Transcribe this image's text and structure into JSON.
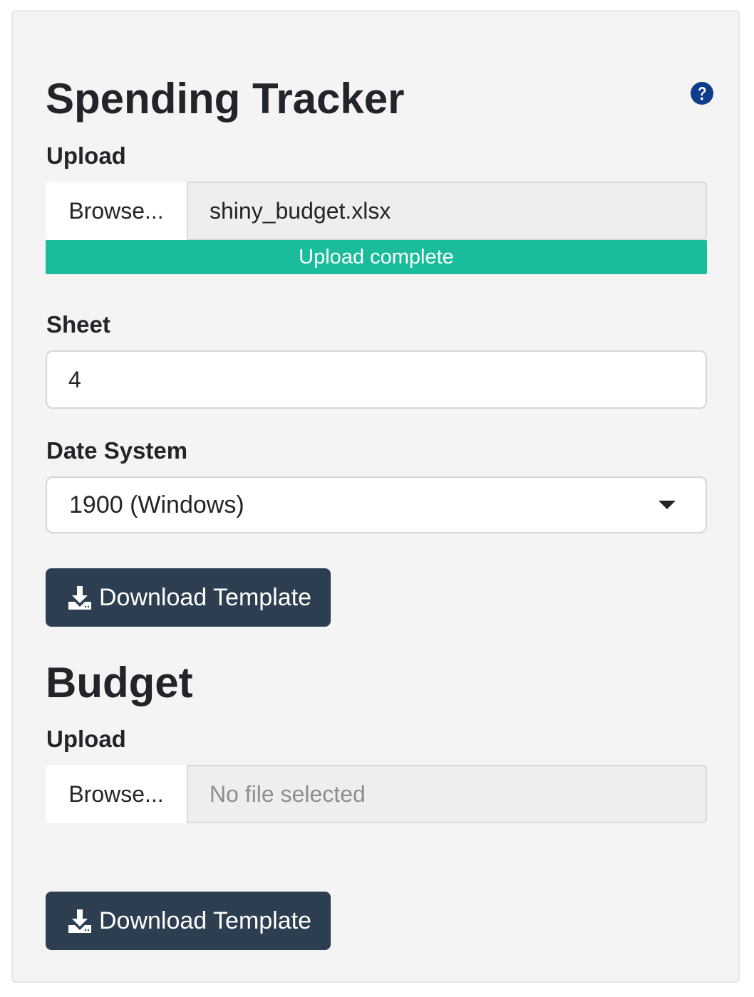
{
  "spending_tracker": {
    "title": "Spending Tracker",
    "upload_label": "Upload",
    "browse_label": "Browse...",
    "file_name": "shiny_budget.xlsx",
    "progress_text": "Upload complete",
    "progress_value": 1.0,
    "sheet_label": "Sheet",
    "sheet_value": "4",
    "date_system_label": "Date System",
    "date_system_value": "1900 (Windows)",
    "download_label": "Download Template"
  },
  "budget": {
    "title": "Budget",
    "upload_label": "Upload",
    "browse_label": "Browse...",
    "file_placeholder": "No file selected",
    "download_label": "Download Template"
  },
  "icons": {
    "help": "question-circle-icon",
    "download": "download-icon",
    "caret": "caret-down-icon"
  },
  "colors": {
    "panel_bg": "#f4f4f4",
    "progress": "#1abc9c",
    "button": "#2c3e50",
    "help_icon": "#0d3c8c"
  }
}
